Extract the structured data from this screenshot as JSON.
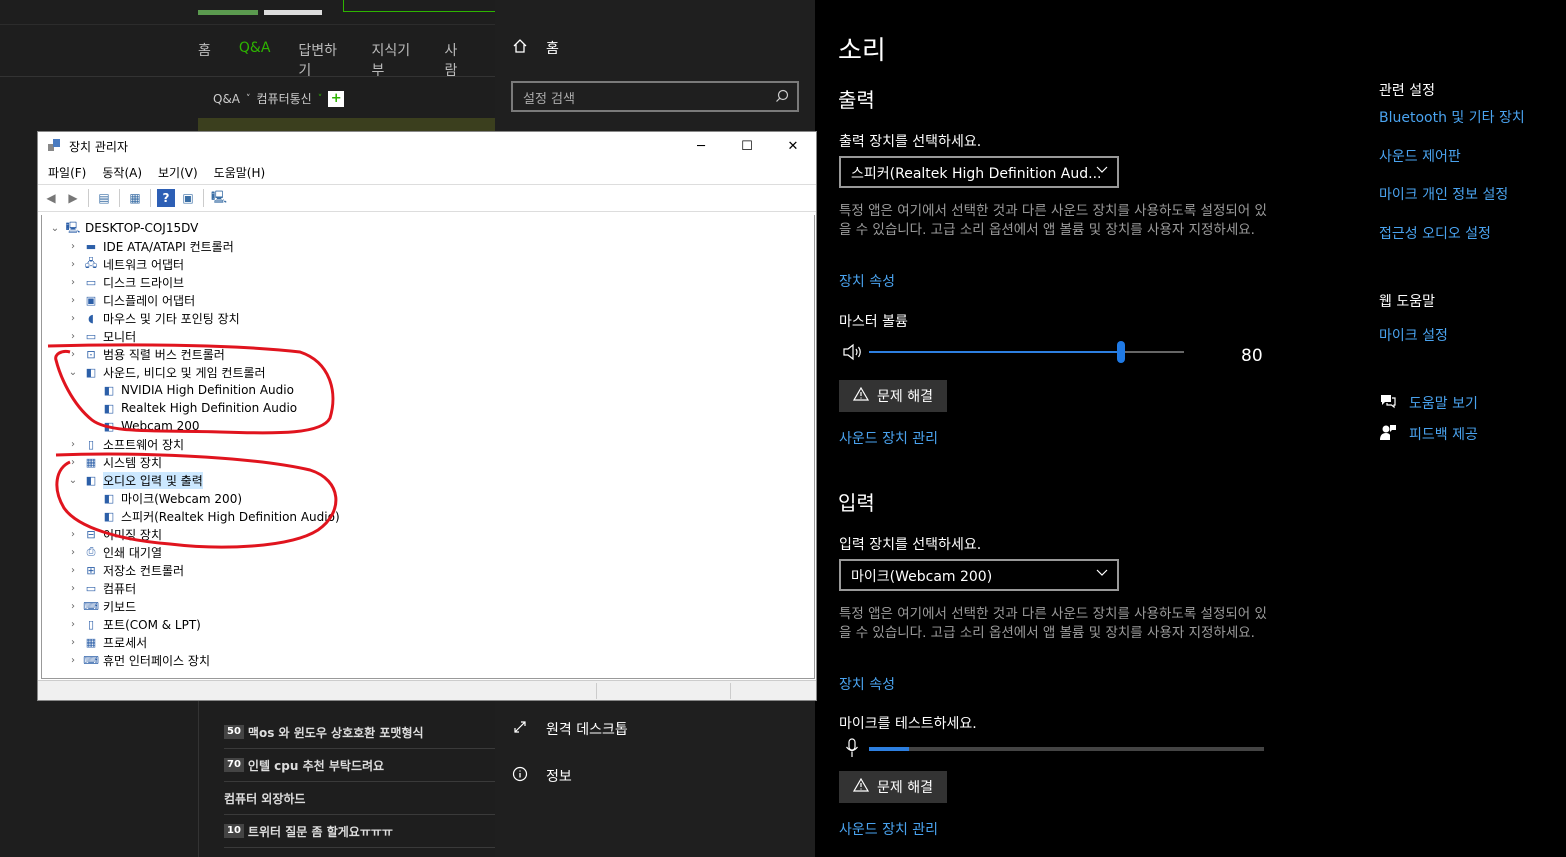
{
  "browser": {
    "nav_tabs": [
      "홈",
      "Q&A",
      "답변하기",
      "지식기부",
      "사람"
    ],
    "active_tab": "Q&A",
    "breadcrumb": {
      "part1": "Q&A",
      "part2": "컴퓨터통신",
      "plus": "+"
    },
    "questions": [
      {
        "num": "50",
        "text": "맥os 와 윈도우 상호호환 포맷형식"
      },
      {
        "num": "70",
        "text": "인텔 cpu 추천 부탁드려요"
      },
      {
        "num": "",
        "text": "컴퓨터 외장하드"
      },
      {
        "num": "10",
        "text": "트위터 질문 좀 할게요ㅠㅠㅠ"
      }
    ]
  },
  "settings_nav": {
    "home": "홈",
    "search_placeholder": "설정 검색",
    "remote_desktop": "원격 데스크톱",
    "about": "정보"
  },
  "sound": {
    "title": "소리",
    "output": {
      "heading": "출력",
      "select_label": "출력 장치를 선택하세요.",
      "device": "스피커(Realtek High Definition Aud...",
      "desc": "특정 앱은 여기에서 선택한 것과 다른 사운드 장치를 사용하도록 설정되어 있을 수 있습니다. 고급 소리 옵션에서 앱 볼륨 및 장치를 사용자 지정하세요.",
      "device_props": "장치 속성",
      "master_volume_label": "마스터 볼륨",
      "volume_value": "80",
      "volume": 80,
      "troubleshoot": "문제 해결",
      "manage": "사운드 장치 관리"
    },
    "input": {
      "heading": "입력",
      "select_label": "입력 장치를 선택하세요.",
      "device": "마이크(Webcam 200)",
      "desc": "특정 앱은 여기에서 선택한 것과 다른 사운드 장치를 사용하도록 설정되어 있을 수 있습니다. 고급 소리 옵션에서 앱 볼륨 및 장치를 사용자 지정하세요.",
      "device_props": "장치 속성",
      "test_label": "마이크를 테스트하세요.",
      "level": 0.1,
      "troubleshoot": "문제 해결",
      "manage": "사운드 장치 관리"
    },
    "related": {
      "heading": "관련 설정",
      "links": [
        "Bluetooth 및 기타 장치",
        "사운드 제어판",
        "마이크 개인 정보 설정",
        "접근성 오디오 설정"
      ]
    },
    "help": {
      "heading": "웹 도움말",
      "link": "마이크 설정",
      "get_help": "도움말 보기",
      "feedback": "피드백 제공"
    }
  },
  "devmgr": {
    "title": "장치 관리자",
    "menu": [
      "파일(F)",
      "동작(A)",
      "보기(V)",
      "도움말(H)"
    ],
    "root": "DESKTOP-COJ15DV",
    "categories": [
      {
        "label": "IDE ATA/ATAPI 컨트롤러",
        "expanded": false
      },
      {
        "label": "네트워크 어댑터",
        "expanded": false
      },
      {
        "label": "디스크 드라이브",
        "expanded": false
      },
      {
        "label": "디스플레이 어댑터",
        "expanded": false
      },
      {
        "label": "마우스 및 기타 포인팅 장치",
        "expanded": false
      },
      {
        "label": "모니터",
        "expanded": false
      },
      {
        "label": "범용 직렬 버스 컨트롤러",
        "expanded": false
      },
      {
        "label": "사운드, 비디오 및 게임 컨트롤러",
        "expanded": true,
        "children": [
          "NVIDIA High Definition Audio",
          "Realtek High Definition Audio",
          "Webcam 200"
        ]
      },
      {
        "label": "소프트웨어 장치",
        "expanded": false
      },
      {
        "label": "시스템 장치",
        "expanded": false
      },
      {
        "label": "오디오 입력 및 출력",
        "expanded": true,
        "selected": true,
        "children": [
          "마이크(Webcam 200)",
          "스피커(Realtek High Definition Audio)"
        ]
      },
      {
        "label": "이미징 장치",
        "expanded": false
      },
      {
        "label": "인쇄 대기열",
        "expanded": false
      },
      {
        "label": "저장소 컨트롤러",
        "expanded": false
      },
      {
        "label": "컴퓨터",
        "expanded": false
      },
      {
        "label": "키보드",
        "expanded": false
      },
      {
        "label": "포트(COM & LPT)",
        "expanded": false
      },
      {
        "label": "프로세서",
        "expanded": false
      },
      {
        "label": "휴먼 인터페이스 장치",
        "expanded": false
      }
    ]
  },
  "colors": {
    "accent": "#4aa3ef",
    "slider": "#1f7ae6",
    "annotation": "#e0141e",
    "naver_green": "#2db400"
  }
}
